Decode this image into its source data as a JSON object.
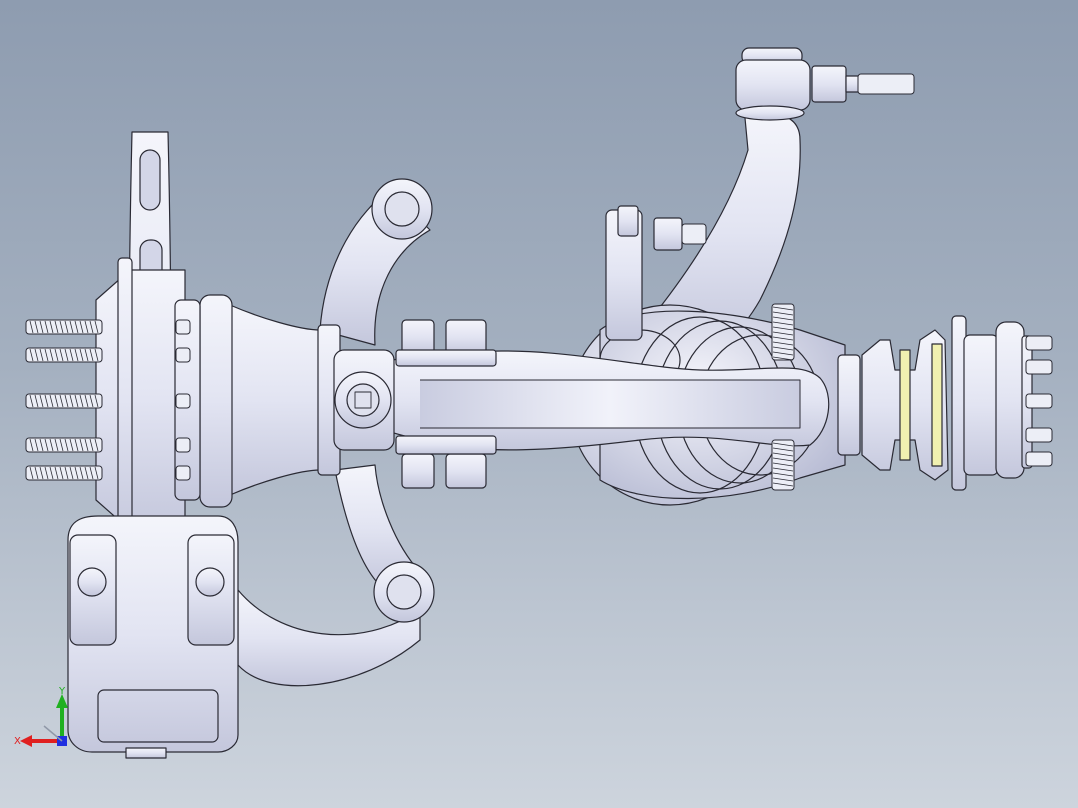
{
  "viewport": {
    "background_top": "#8e9cb0",
    "background_bottom": "#cdd4dd",
    "model_fill": "#e6e8f4",
    "model_shade": "#c6c9de",
    "model_edge": "#2a2a34"
  },
  "triad": {
    "x_label": "X",
    "y_label": "Y",
    "x_color": "#e02020",
    "y_color": "#20b020",
    "z_color": "#2030e0"
  }
}
